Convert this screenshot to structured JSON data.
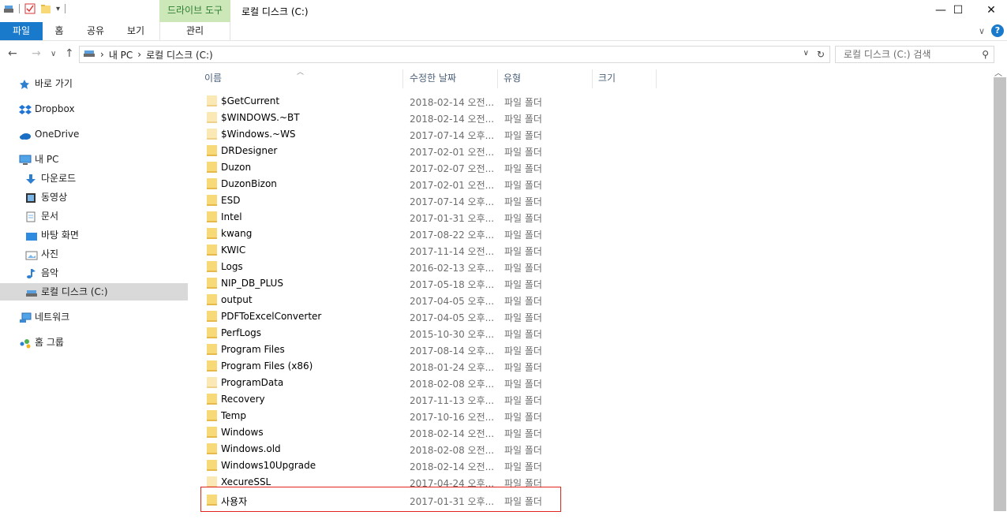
{
  "window": {
    "title": "로컬 디스크 (C:)",
    "context_tab": "드라이브 도구",
    "minimize": "—",
    "maximize": "☐",
    "close": "✕"
  },
  "ribbon": {
    "tabs": [
      "파일",
      "홈",
      "공유",
      "보기"
    ],
    "context_sub": "관리",
    "collapse": "∨",
    "help": "?"
  },
  "address": {
    "back": "←",
    "forward": "→",
    "recent": "∨",
    "up": "↑",
    "crumbs": [
      "내 PC",
      "로컬 디스크 (C:)"
    ],
    "crumb_sep": "›",
    "dropdown": "∨",
    "refresh": "↻",
    "search_placeholder": "로컬 디스크 (C:) 검색"
  },
  "nav": {
    "items": [
      {
        "label": "바로 가기",
        "icon": "star-icon"
      },
      {
        "label": "Dropbox",
        "icon": "dropbox-icon"
      },
      {
        "label": "OneDrive",
        "icon": "cloud-icon"
      },
      {
        "label": "내 PC",
        "icon": "computer-icon"
      },
      {
        "label": "다운로드",
        "icon": "download-icon"
      },
      {
        "label": "동영상",
        "icon": "video-icon"
      },
      {
        "label": "문서",
        "icon": "document-icon"
      },
      {
        "label": "바탕 화면",
        "icon": "desktop-icon"
      },
      {
        "label": "사진",
        "icon": "picture-icon"
      },
      {
        "label": "음악",
        "icon": "music-icon"
      },
      {
        "label": "로컬 디스크 (C:)",
        "icon": "drive-icon"
      },
      {
        "label": "네트워크",
        "icon": "network-icon"
      },
      {
        "label": "홈 그룹",
        "icon": "homegroup-icon"
      }
    ]
  },
  "columns": [
    "이름",
    "수정한 날짜",
    "유형",
    "크기"
  ],
  "files": [
    {
      "name": "$GetCurrent",
      "date": "2018-02-14 오전...",
      "type": "파일 폴더",
      "hidden": true
    },
    {
      "name": "$WINDOWS.~BT",
      "date": "2018-02-14 오전...",
      "type": "파일 폴더",
      "hidden": true
    },
    {
      "name": "$Windows.~WS",
      "date": "2017-07-14 오후...",
      "type": "파일 폴더",
      "hidden": true
    },
    {
      "name": "DRDesigner",
      "date": "2017-02-01 오전...",
      "type": "파일 폴더",
      "hidden": false
    },
    {
      "name": "Duzon",
      "date": "2017-02-07 오전...",
      "type": "파일 폴더",
      "hidden": false
    },
    {
      "name": "DuzonBizon",
      "date": "2017-02-01 오전...",
      "type": "파일 폴더",
      "hidden": false
    },
    {
      "name": "ESD",
      "date": "2017-07-14 오후...",
      "type": "파일 폴더",
      "hidden": false
    },
    {
      "name": "Intel",
      "date": "2017-01-31 오후...",
      "type": "파일 폴더",
      "hidden": false
    },
    {
      "name": "kwang",
      "date": "2017-08-22 오후...",
      "type": "파일 폴더",
      "hidden": false
    },
    {
      "name": "KWIC",
      "date": "2017-11-14 오전...",
      "type": "파일 폴더",
      "hidden": false
    },
    {
      "name": "Logs",
      "date": "2016-02-13 오후...",
      "type": "파일 폴더",
      "hidden": false
    },
    {
      "name": "NIP_DB_PLUS",
      "date": "2017-05-18 오후...",
      "type": "파일 폴더",
      "hidden": false
    },
    {
      "name": "output",
      "date": "2017-04-05 오후...",
      "type": "파일 폴더",
      "hidden": false
    },
    {
      "name": "PDFToExcelConverter",
      "date": "2017-04-05 오후...",
      "type": "파일 폴더",
      "hidden": false
    },
    {
      "name": "PerfLogs",
      "date": "2015-10-30 오후...",
      "type": "파일 폴더",
      "hidden": false
    },
    {
      "name": "Program Files",
      "date": "2017-08-14 오후...",
      "type": "파일 폴더",
      "hidden": false
    },
    {
      "name": "Program Files (x86)",
      "date": "2018-01-24 오후...",
      "type": "파일 폴더",
      "hidden": false
    },
    {
      "name": "ProgramData",
      "date": "2018-02-08 오후...",
      "type": "파일 폴더",
      "hidden": true
    },
    {
      "name": "Recovery",
      "date": "2017-11-13 오후...",
      "type": "파일 폴더",
      "hidden": false
    },
    {
      "name": "Temp",
      "date": "2017-10-16 오전...",
      "type": "파일 폴더",
      "hidden": false
    },
    {
      "name": "Windows",
      "date": "2018-02-14 오전...",
      "type": "파일 폴더",
      "hidden": false
    },
    {
      "name": "Windows.old",
      "date": "2018-02-08 오전...",
      "type": "파일 폴더",
      "hidden": false
    },
    {
      "name": "Windows10Upgrade",
      "date": "2018-02-14 오전...",
      "type": "파일 폴더",
      "hidden": false
    },
    {
      "name": "XecureSSL",
      "date": "2017-04-24 오후...",
      "type": "파일 폴더",
      "hidden": true
    },
    {
      "name": "사용자",
      "date": "2017-01-31 오후...",
      "type": "파일 폴더",
      "hidden": false
    }
  ]
}
